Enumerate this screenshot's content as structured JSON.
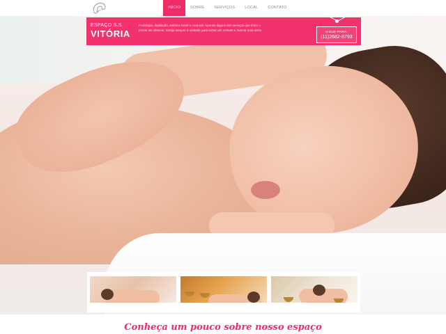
{
  "nav": {
    "items": [
      {
        "label": "INÍCIO",
        "active": true
      },
      {
        "label": "SOBRE",
        "active": false
      },
      {
        "label": "SERVIÇOS",
        "active": false
      },
      {
        "label": "LOCAL",
        "active": false
      },
      {
        "label": "CONTATO",
        "active": false
      }
    ]
  },
  "brand": {
    "subtitle": "ESPAÇO S.S.",
    "name": "VITÓRIA"
  },
  "banner": {
    "description": "Podologia, depilação, estética facial e corporal. Apenas alguns dos serviços que tiram o prazer de oferecer. Esteja sempre à vontade para entrar em contato e marcar uma visita."
  },
  "phone": {
    "label": "LIGUE PARA:",
    "number": "(11)2682-8793"
  },
  "section": {
    "title": "Conheça um pouco sobre nosso espaço"
  },
  "colors": {
    "accent": "#ee2a67",
    "banner": "#f2326c"
  },
  "icons": {
    "logo": "face-silhouette-logo"
  }
}
